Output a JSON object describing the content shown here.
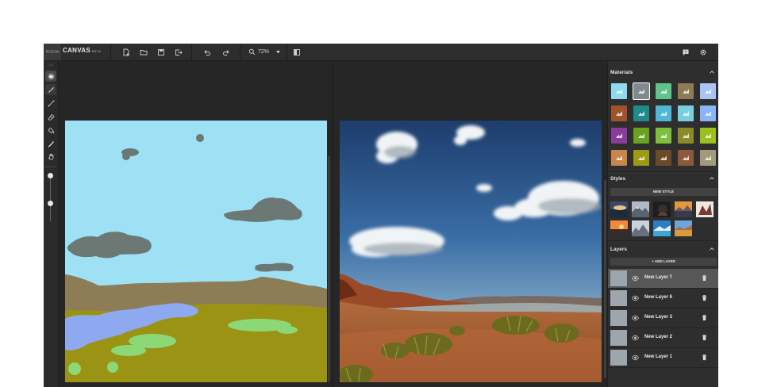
{
  "app": {
    "logo_text": "NVIDIA",
    "name": "CANVAS",
    "badge": "BETA"
  },
  "toolbar": {
    "zoom_value": "72%",
    "icons": [
      "new-file-icon",
      "open-folder-icon",
      "save-icon",
      "export-icon",
      "undo-icon",
      "redo-icon",
      "zoom-icon",
      "toggle-view-icon",
      "feedback-icon",
      "settings-icon"
    ]
  },
  "tools": [
    "grip-icon",
    "materials-cloud-icon",
    "brush-icon",
    "line-icon",
    "eraser-icon",
    "fill-icon",
    "eyedropper-icon",
    "pan-hand-icon"
  ],
  "panel": {
    "materials": {
      "title": "Materials",
      "items": [
        {
          "color": "#8fd9ee"
        },
        {
          "color": "#7f8a8f"
        },
        {
          "color": "#5fc48a"
        },
        {
          "color": "#8e7a56"
        },
        {
          "color": "#a9c4f4"
        },
        {
          "color": "#a0522d"
        },
        {
          "color": "#1e8a8a"
        },
        {
          "color": "#4fb8d8"
        },
        {
          "color": "#79cfe0"
        },
        {
          "color": "#8ab4f8"
        },
        {
          "color": "#8a3c9c"
        },
        {
          "color": "#6aa121"
        },
        {
          "color": "#7dbf3c"
        },
        {
          "color": "#8a8a2a"
        },
        {
          "color": "#9bbf1c"
        },
        {
          "color": "#c8864a"
        },
        {
          "color": "#9c9c14"
        },
        {
          "color": "#6b4a28"
        },
        {
          "color": "#8a5a3a"
        },
        {
          "color": "#a39a7a"
        }
      ],
      "selected_index": 1
    },
    "styles": {
      "title": "Styles",
      "new_button": "NEW STYLE"
    },
    "layers": {
      "title": "Layers",
      "add_button": "+ ADD LAYER",
      "items": [
        {
          "name": "New Layer 7",
          "active": true
        },
        {
          "name": "New Layer 6",
          "active": false
        },
        {
          "name": "New Layer 3",
          "active": false
        },
        {
          "name": "New Layer 2",
          "active": false
        },
        {
          "name": "New Layer 1",
          "active": false
        }
      ]
    }
  }
}
